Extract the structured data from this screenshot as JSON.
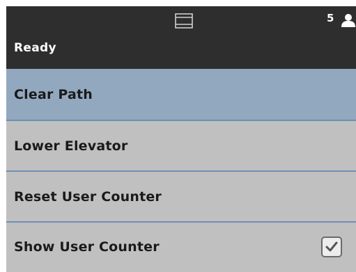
{
  "status_bar": {
    "title": "Ready",
    "user_count": "5",
    "icons": [
      "scanner-icon",
      "user-icon"
    ]
  },
  "menu": {
    "items": [
      {
        "label": "Clear Path",
        "selected": true
      },
      {
        "label": "Lower Elevator",
        "selected": false
      },
      {
        "label": "Reset User Counter",
        "selected": false
      },
      {
        "label": "Show User Counter",
        "selected": false,
        "checked": true
      }
    ]
  },
  "colors": {
    "status_bar_bg": "#2e2e2e",
    "selected_bg": "#92a8bf",
    "item_bg": "#c0c0c0",
    "divider": "#6e8fb3"
  }
}
